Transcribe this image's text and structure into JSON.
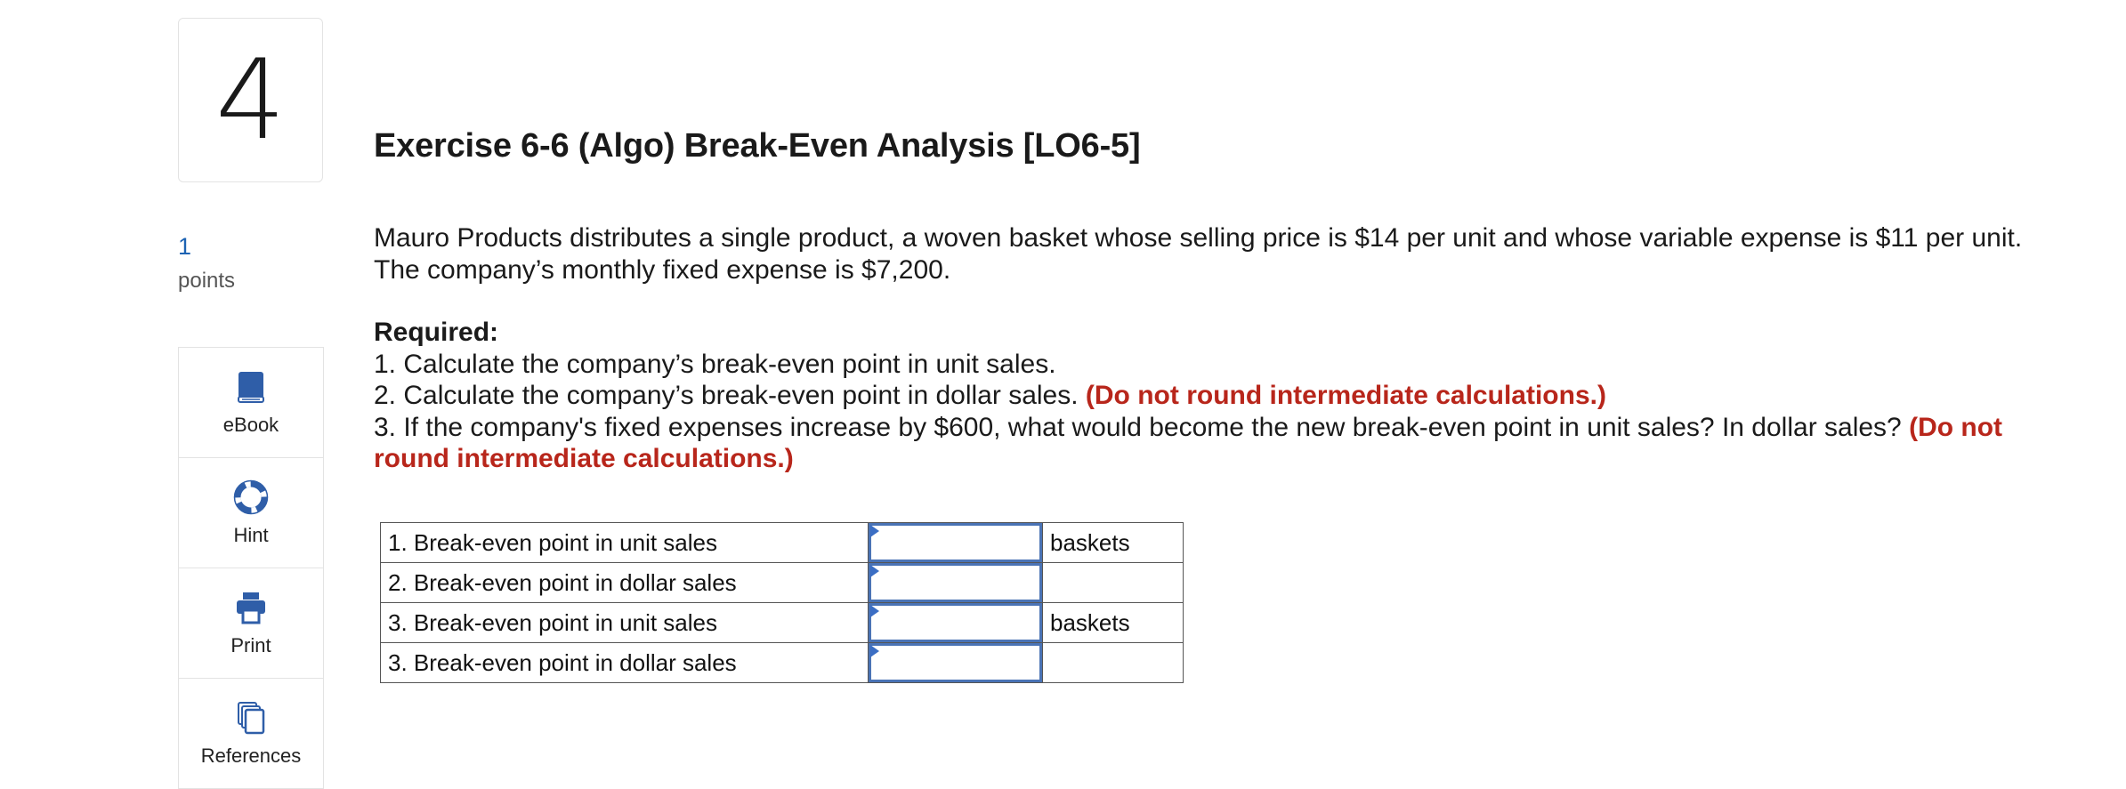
{
  "question": {
    "number": "4",
    "points_value": "1",
    "points_label": "points"
  },
  "tools": [
    {
      "label": "eBook",
      "icon": "book-icon"
    },
    {
      "label": "Hint",
      "icon": "lifebuoy-icon"
    },
    {
      "label": "Print",
      "icon": "printer-icon"
    },
    {
      "label": "References",
      "icon": "documents-icon"
    }
  ],
  "exercise": {
    "title": "Exercise 6-6 (Algo) Break-Even Analysis [LO6-5]",
    "intro": "Mauro Products distributes a single product, a woven basket whose selling price is $14 per unit and whose variable expense is $11 per unit. The company’s monthly fixed expense is $7,200.",
    "required_heading": "Required:",
    "req1": "1. Calculate the company’s break-even point in unit sales.",
    "req2": "2. Calculate the company’s break-even point in dollar sales.",
    "req2_note": "(Do not round intermediate calculations.)",
    "req3": "3. If the company's fixed expenses increase by $600, what would become the new break-even point in unit sales? In dollar sales?",
    "req3_note": "(Do not round intermediate calculations.)"
  },
  "answers_table": {
    "rows": [
      {
        "label": "1. Break-even point in unit sales",
        "value": "",
        "unit": "baskets"
      },
      {
        "label": "2. Break-even point in dollar sales",
        "value": "",
        "unit": ""
      },
      {
        "label": "3. Break-even point in unit sales",
        "value": "",
        "unit": "baskets"
      },
      {
        "label": "3. Break-even point in dollar sales",
        "value": "",
        "unit": ""
      }
    ]
  },
  "colors": {
    "accent_blue": "#1d63b3",
    "icon_blue": "#2f5ea8",
    "note_red": "#b8261b",
    "input_border": "#4a73b5"
  }
}
